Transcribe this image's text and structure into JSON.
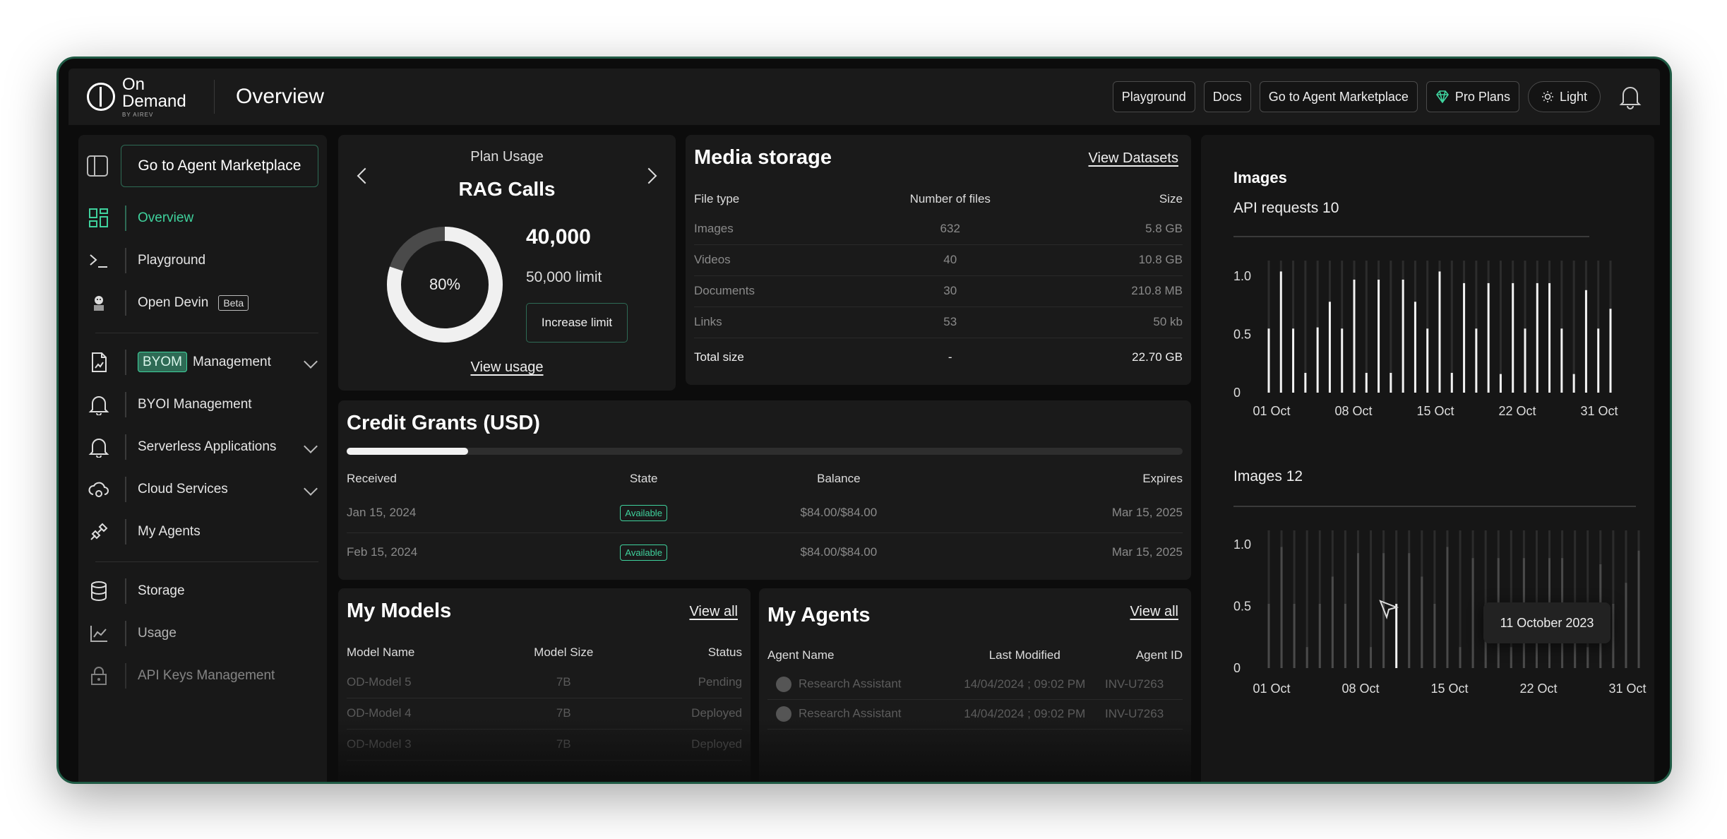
{
  "brand": {
    "line1": "On",
    "line2": "Demand",
    "line3": "BY AIREV"
  },
  "header": {
    "title": "Overview",
    "buttons": {
      "playground": "Playground",
      "docs": "Docs",
      "marketplace": "Go to Agent Marketplace",
      "pro": "Pro Plans",
      "theme": "Light"
    }
  },
  "sidebar": {
    "marketplace_button": "Go to Agent Marketplace",
    "items": [
      {
        "label": "Overview",
        "icon": "grid-icon"
      },
      {
        "label": "Playground",
        "icon": "terminal-icon"
      },
      {
        "label": "Open Devin",
        "icon": "devin-icon",
        "badge": "Beta"
      },
      {
        "label": "Management",
        "icon": "file-chart-icon",
        "badge": "BYOM"
      },
      {
        "label": "BYOI Management",
        "icon": "bell-icon"
      },
      {
        "label": "Serverless Applications",
        "icon": "bell-icon"
      },
      {
        "label": "Cloud Services",
        "icon": "cloud-gear-icon"
      },
      {
        "label": "My Agents",
        "icon": "plug-icon"
      },
      {
        "label": "Storage",
        "icon": "database-icon"
      },
      {
        "label": "Usage",
        "icon": "line-chart-icon"
      },
      {
        "label": "API Keys Management",
        "icon": "lock-icon"
      }
    ]
  },
  "plan": {
    "subtitle": "Plan Usage",
    "title": "RAG Calls",
    "percent_label": "80%",
    "percent": 0.8,
    "used": "40,000",
    "limit": "50,000 limit",
    "increase": "Increase limit",
    "view_usage": "View usage"
  },
  "media": {
    "title": "Media storage",
    "link": "View Datasets",
    "headers": [
      "File type",
      "Number of files",
      "Size"
    ],
    "rows": [
      [
        "Images",
        "632",
        "5.8 GB"
      ],
      [
        "Videos",
        "40",
        "10.8 GB"
      ],
      [
        "Documents",
        "30",
        "210.8 MB"
      ],
      [
        "Links",
        "53",
        "50 kb"
      ]
    ],
    "total": [
      "Total size",
      "-",
      "22.70 GB"
    ]
  },
  "credit": {
    "title": "Credit Grants (USD)",
    "progress": 0.145,
    "headers": [
      "Received",
      "State",
      "Balance",
      "Expires"
    ],
    "rows": [
      [
        "Jan 15, 2024",
        "Available",
        "$84.00/$84.00",
        "Mar 15, 2025"
      ],
      [
        "Feb 15, 2024",
        "Available",
        "$84.00/$84.00",
        "Mar 15, 2025"
      ]
    ]
  },
  "models": {
    "title": "My Models",
    "link": "View all",
    "headers": [
      "Model Name",
      "Model Size",
      "Status"
    ],
    "rows": [
      [
        "OD-Model 5",
        "7B",
        "Pending"
      ],
      [
        "OD-Model 4",
        "7B",
        "Deployed"
      ],
      [
        "OD-Model 3",
        "7B",
        "Deployed"
      ]
    ]
  },
  "agents": {
    "title": "My Agents",
    "link": "View all",
    "headers": [
      "Agent Name",
      "Last Modified",
      "Agent ID"
    ],
    "rows": [
      [
        "Research Assistant",
        "14/04/2024 ; 09:02 PM",
        "INV-U7263"
      ],
      [
        "Research Assistant",
        "14/04/2024 ; 09:02 PM",
        "INV-U7263"
      ]
    ]
  },
  "charts_panel": {
    "heading": "Images",
    "tooltip": "11 October 2023"
  },
  "chart_data": [
    {
      "type": "bar",
      "title": "API requests 10",
      "yticks": [
        "1.0",
        "0.5",
        "0"
      ],
      "xticks": [
        "01 Oct",
        "08 Oct",
        "15 Oct",
        "22 Oct",
        "31 Oct"
      ],
      "ylim": [
        0,
        1.0
      ],
      "values": [
        0.55,
        1.04,
        0.55,
        0.17,
        0.56,
        0.78,
        0.55,
        0.97,
        0.17,
        0.97,
        0.17,
        0.97,
        0.78,
        0.55,
        1.04,
        0.17,
        0.94,
        0.55,
        0.94,
        0.16,
        0.94,
        0.55,
        0.94,
        0.94,
        0.55,
        0.16,
        0.88,
        0.55,
        0.72
      ]
    },
    {
      "type": "bar",
      "title": "Images 12",
      "yticks": [
        "1.0",
        "0.5",
        "0"
      ],
      "xticks": [
        "01 Oct",
        "08 Oct",
        "15 Oct",
        "22 Oct",
        "31 Oct"
      ],
      "ylim": [
        0,
        1.0
      ],
      "highlight_index": 10,
      "values": [
        0.52,
        0.98,
        0.52,
        0.17,
        0.52,
        0.74,
        0.52,
        0.93,
        0.17,
        0.93,
        0.52,
        0.93,
        0.74,
        0.52,
        0.98,
        0.17,
        0.89,
        0.52,
        0.89,
        0.17,
        0.89,
        0.52,
        0.89,
        0.89,
        0.52,
        0.17,
        0.84,
        0.52,
        0.69,
        0.95
      ]
    }
  ]
}
